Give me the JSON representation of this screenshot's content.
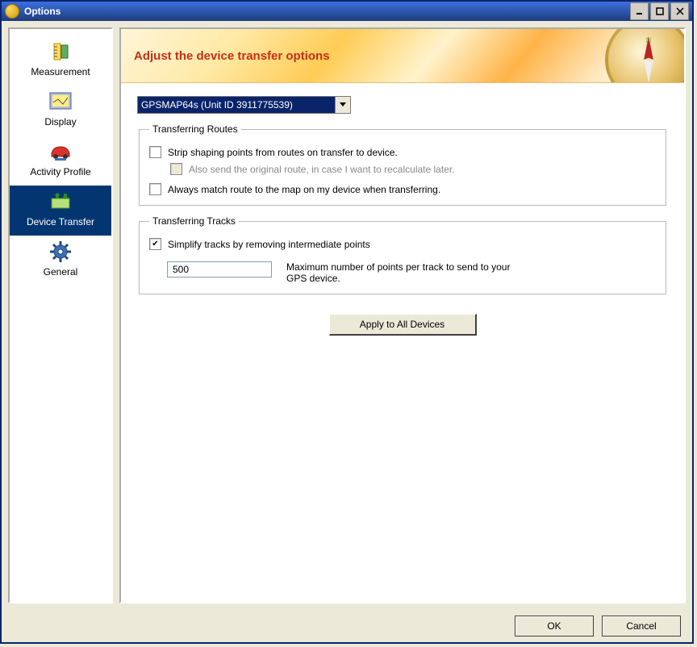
{
  "window": {
    "title": "Options"
  },
  "sidebar": {
    "items": {
      "measurement": "Measurement",
      "display": "Display",
      "activity_profile": "Activity Profile",
      "device_transfer": "Device Transfer",
      "general": "General"
    }
  },
  "header": {
    "title": "Adjust the device transfer options"
  },
  "device_select": {
    "label": "GPSMAP64s (Unit ID 3911775539)"
  },
  "groups": {
    "routes": {
      "legend": "Transferring Routes",
      "strip": "Strip shaping points from routes on transfer to device.",
      "also_send": "Also send the original route, in case I want to recalculate later.",
      "always_match": "Always match route to the map on my device when transferring."
    },
    "tracks": {
      "legend": "Transferring Tracks",
      "simplify": "Simplify tracks by removing intermediate points",
      "max_points_value": "500",
      "max_points_label": "Maximum number of points per track to send to your GPS device."
    }
  },
  "buttons": {
    "apply_all": "Apply to All Devices",
    "ok": "OK",
    "cancel": "Cancel"
  }
}
